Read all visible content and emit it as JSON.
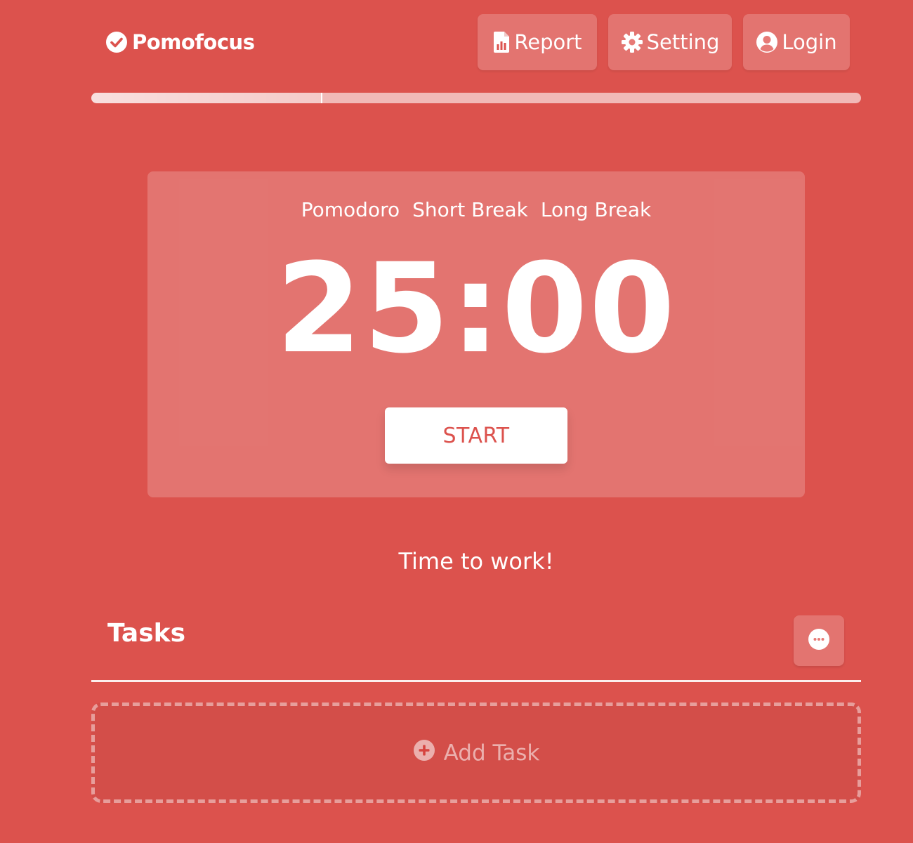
{
  "app": {
    "name": "Pomofocus",
    "accent_color": "#dc524d"
  },
  "nav": {
    "report_label": "Report",
    "setting_label": "Setting",
    "login_label": "Login"
  },
  "progress": {
    "fraction": 0.3
  },
  "timer": {
    "modes": [
      "Pomodoro",
      "Short Break",
      "Long Break"
    ],
    "active_mode": "Pomodoro",
    "time": "25:00",
    "start_label": "START"
  },
  "status": {
    "message": "Time to work!"
  },
  "tasks": {
    "title": "Tasks",
    "add_label": "Add Task"
  },
  "icons": {
    "logo": "check-circle-icon",
    "report": "report-icon",
    "setting": "gear-icon",
    "login": "user-circle-icon",
    "tasks_menu": "more-options-icon",
    "add_task": "plus-circle-icon"
  }
}
